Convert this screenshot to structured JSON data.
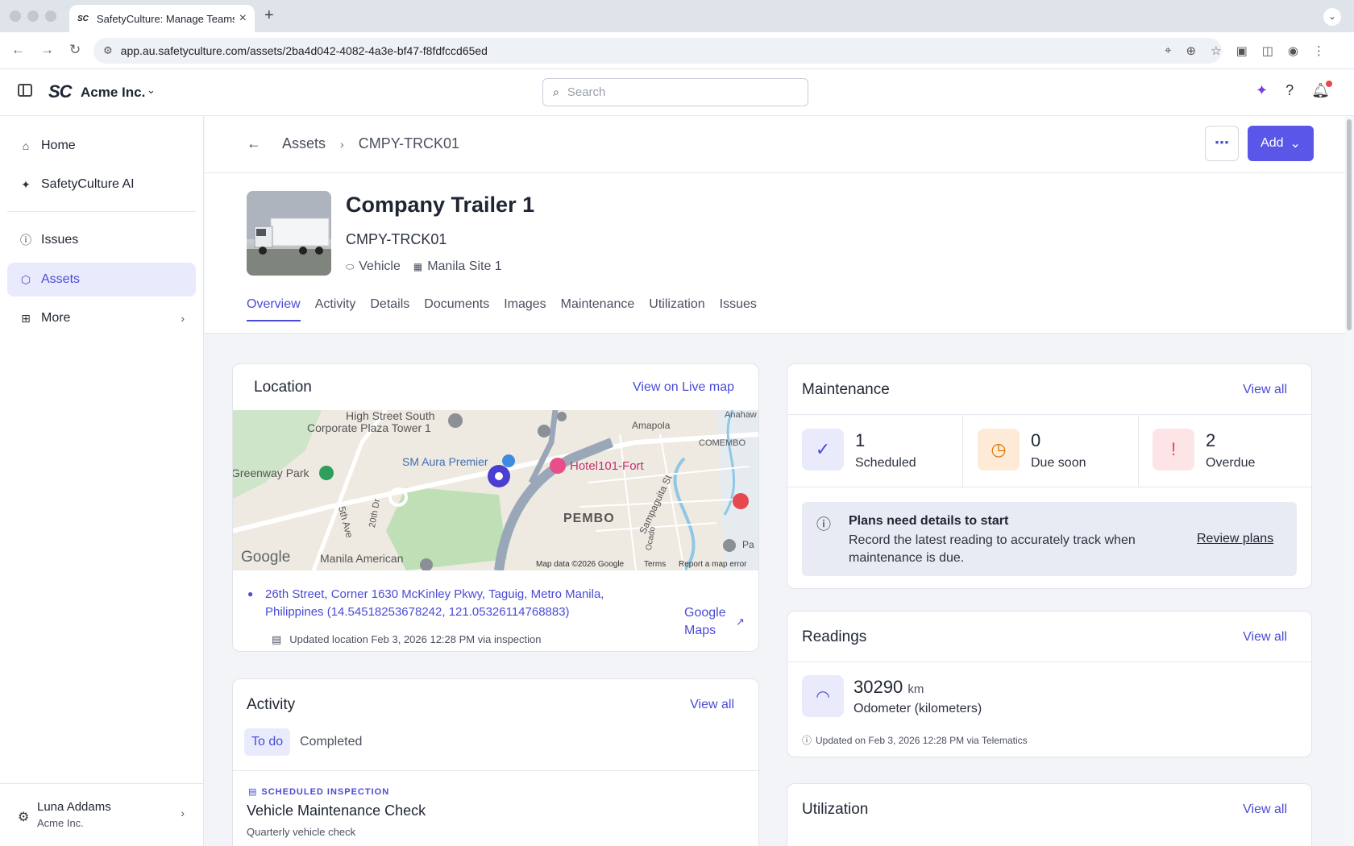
{
  "browser": {
    "tab_title": "SafetyCulture: Manage Teams",
    "url": "app.au.safetyculture.com/assets/2ba4d042-4082-4a3e-bf47-f8fdfccd65ed"
  },
  "header": {
    "logo": "SC",
    "org_name": "Acme Inc.",
    "search_placeholder": "Search"
  },
  "sidebar": {
    "items": [
      {
        "label": "Home",
        "icon": "home-icon"
      },
      {
        "label": "SafetyCulture AI",
        "icon": "sparkle-icon"
      },
      {
        "label": "Issues",
        "icon": "issue-icon"
      },
      {
        "label": "Assets",
        "icon": "cube-icon"
      },
      {
        "label": "More",
        "icon": "grid-icon"
      }
    ],
    "user": {
      "name": "Luna Addams",
      "org": "Acme Inc."
    }
  },
  "page": {
    "breadcrumb": [
      "Assets",
      "CMPY-TRCK01"
    ],
    "add_label": "Add",
    "asset_title": "Company Trailer 1",
    "asset_code": "CMPY-TRCK01",
    "asset_type": "Vehicle",
    "asset_site": "Manila Site 1",
    "tabs": [
      "Overview",
      "Activity",
      "Details",
      "Documents",
      "Images",
      "Maintenance",
      "Utilization",
      "Issues"
    ]
  },
  "location": {
    "title": "Location",
    "view_link": "View on Live map",
    "map_labels": [
      "High Street South",
      "Corporate Plaza Tower 1",
      "SM Aura Premier",
      "Hotel101-Fort",
      "Amapola",
      "COMEMBO",
      "Anahaw",
      "Greenway Park",
      "PEMBO",
      "Sampaguita St",
      "5th Ave",
      "20th Dr",
      "Manila American",
      "Ocado",
      "Pa"
    ],
    "map_footer": [
      "Map data ©2026 Google",
      "Terms",
      "Report a map error"
    ],
    "google_logo": "Google",
    "address": "26th Street, Corner 1630 McKinley Pkwy, Taguig, Metro Manila, Philippines (14.54518253678242, 121.05326114768883)",
    "updated": "Updated location Feb 3, 2026 12:28 PM via inspection",
    "gmaps_label": "Google Maps"
  },
  "maintenance": {
    "title": "Maintenance",
    "view_link": "View all",
    "stats": [
      {
        "value": "1",
        "label": "Scheduled",
        "color": "#e9ebfd",
        "icon_color": "#4a4bd6"
      },
      {
        "value": "0",
        "label": "Due soon",
        "color": "#fdebd8",
        "icon_color": "#d97706"
      },
      {
        "value": "2",
        "label": "Overdue",
        "color": "#fde5e7",
        "icon_color": "#e5484d"
      }
    ],
    "notice_title": "Plans need details to start",
    "notice_body": "Record the latest reading to accurately track when maintenance is due.",
    "notice_link": "Review plans"
  },
  "readings": {
    "title": "Readings",
    "view_link": "View all",
    "value": "30290",
    "unit": "km",
    "label": "Odometer (kilometers)",
    "updated": "Updated on Feb 3, 2026 12:28 PM via Telematics"
  },
  "activity": {
    "title": "Activity",
    "view_link": "View all",
    "tabs": [
      "To do",
      "Completed"
    ],
    "item_tag": "SCHEDULED INSPECTION",
    "item_title": "Vehicle Maintenance Check",
    "item_sub": "Quarterly vehicle check"
  },
  "utilization": {
    "title": "Utilization",
    "view_link": "View all"
  }
}
